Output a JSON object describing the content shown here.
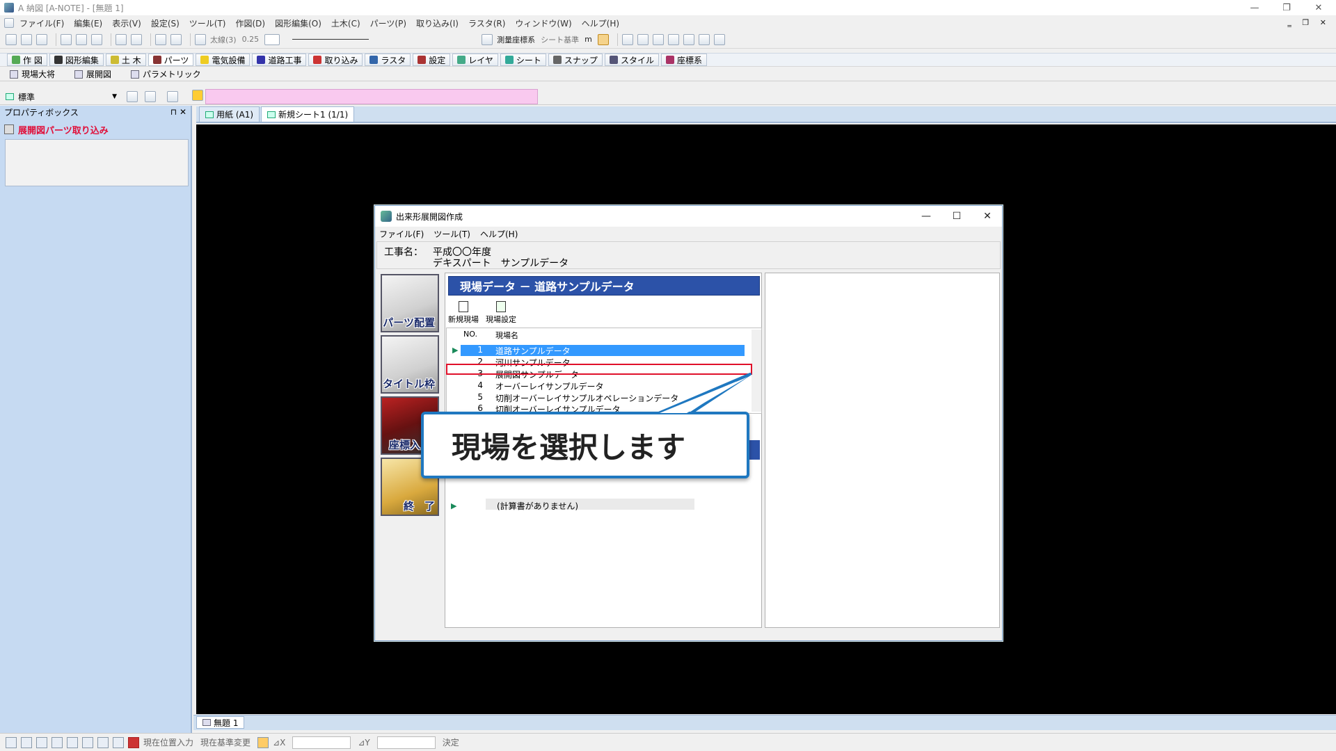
{
  "window": {
    "title": "A 納図 [A-NOTE] - [無題 1]",
    "controls": [
      "—",
      "❐",
      "✕"
    ]
  },
  "menubar": {
    "items": [
      "ファイル(F)",
      "編集(E)",
      "表示(V)",
      "設定(S)",
      "ツール(T)",
      "作図(D)",
      "図形編集(O)",
      "土木(C)",
      "パーツ(P)",
      "取り込み(I)",
      "ラスタ(R)",
      "ウィンドウ(W)",
      "ヘルプ(H)"
    ],
    "mdi_controls": "‗ ❐ ✕"
  },
  "toolbar1": {
    "line_type": "太線(3)",
    "line_width": "0.25",
    "coord_system": "測量座標系",
    "sheet_basis": "シート基準",
    "unit": "m"
  },
  "toolbar2": {
    "modes": [
      "作 図",
      "図形編集",
      "土 木",
      "パーツ",
      "電気設備",
      "道路工事",
      "取り込み",
      "ラスタ",
      "設定",
      "レイヤ",
      "シート",
      "スナップ",
      "スタイル",
      "座標系"
    ]
  },
  "toolbar3": {
    "items": [
      "現場大将",
      "展開図",
      "パラメトリック"
    ]
  },
  "layer": {
    "selected": "標準"
  },
  "properties": {
    "title": "プロパティボックス",
    "pin_close": "⊓ ✕",
    "item": "展開図パーツ取り込み"
  },
  "doc_tabs": [
    "用紙 (A1)",
    "新規シート1 (1/1)"
  ],
  "bottom_tab": "無題 1",
  "status": {
    "pos_input": "現在位置入力",
    "basis_change": "現在基準変更",
    "dx_label": "⊿X",
    "dy_label": "⊿Y",
    "confirm": "決定"
  },
  "dialog": {
    "title": "出来形展開図作成",
    "controls": [
      "—",
      "☐",
      "✕"
    ],
    "menu": [
      "ファイル(F)",
      "ツール(T)",
      "ヘルプ(H)"
    ],
    "project_label": "工事名：",
    "project_name_1": "平成〇〇年度",
    "project_name_2": "デキスパート　サンプルデータ",
    "side_buttons": [
      "パーツ配置",
      "タイトル枠",
      "座標入",
      "終　了"
    ],
    "header": "現場データ － 道路サンプルデータ",
    "tools": [
      "新規現場",
      "現場設定"
    ],
    "list_columns": [
      "NO.",
      "現場名"
    ],
    "sites": [
      {
        "no": "1",
        "name": "道路サンプルデータ"
      },
      {
        "no": "2",
        "name": "河川サンプルデータ"
      },
      {
        "no": "3",
        "name": "展開図サンプルデータ"
      },
      {
        "no": "4",
        "name": "オーバーレイサンプルデータ"
      },
      {
        "no": "5",
        "name": "切削オーバーレイサンプルオペレーションデータ"
      },
      {
        "no": "6",
        "name": "切削オーバーレイサンプルデータ"
      }
    ],
    "selected_index": 0,
    "highlighted_index": 2,
    "no_calc": "(計算書がありません)"
  },
  "callout": {
    "text": "現場を選択します"
  }
}
